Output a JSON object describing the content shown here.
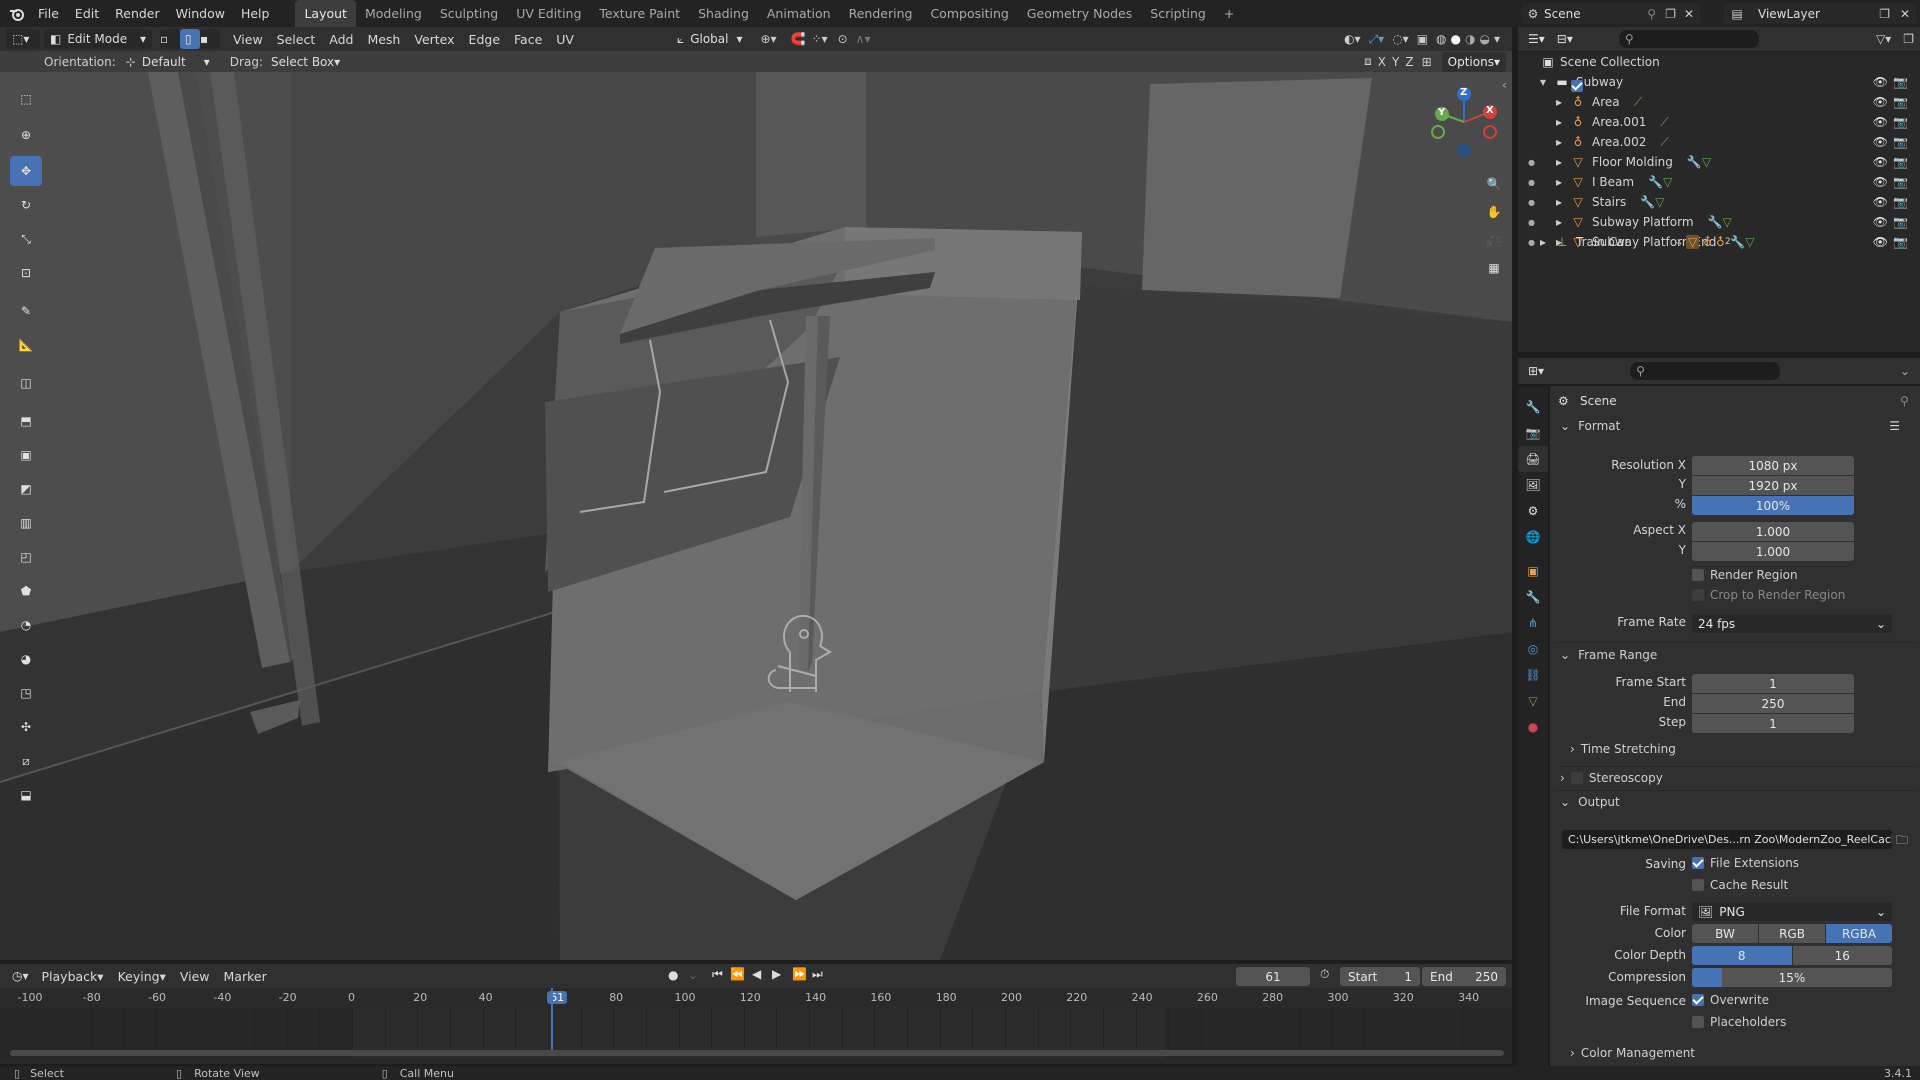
{
  "topbar": {
    "menus": [
      "File",
      "Edit",
      "Render",
      "Window",
      "Help"
    ],
    "workspaces": [
      "Layout",
      "Modeling",
      "Sculpting",
      "UV Editing",
      "Texture Paint",
      "Shading",
      "Animation",
      "Rendering",
      "Compositing",
      "Geometry Nodes",
      "Scripting"
    ],
    "active_workspace": "Layout",
    "add_tab": "+",
    "scene_label": "Scene",
    "viewlayer_label": "ViewLayer"
  },
  "viewport_header": {
    "mode": "Edit Mode",
    "menus": [
      "View",
      "Select",
      "Add",
      "Mesh",
      "Vertex",
      "Edge",
      "Face",
      "UV"
    ],
    "transform_orientation": "Global",
    "orientation_label": "Orientation:",
    "orientation_value": "Default",
    "drag_label": "Drag:",
    "drag_value": "Select Box",
    "axis_x": "X",
    "axis_y": "Y",
    "axis_z": "Z",
    "options": "Options"
  },
  "gizmo": {
    "x": "X",
    "y": "Y",
    "z": "Z"
  },
  "tools": [
    "select-box",
    "cursor",
    "move",
    "rotate",
    "scale",
    "transform",
    "annotate",
    "measure",
    "add-cube",
    "extrude",
    "inset",
    "bevel",
    "loop-cut",
    "knife",
    "poly-build",
    "spin",
    "smooth",
    "edge-slide",
    "shrink-fatten",
    "shear",
    "rip"
  ],
  "outliner": {
    "search_placeholder": "",
    "root": "Scene Collection",
    "collection": "Subway",
    "items": [
      {
        "name": "Area",
        "type": "light"
      },
      {
        "name": "Area.001",
        "type": "light"
      },
      {
        "name": "Area.002",
        "type": "light"
      },
      {
        "name": "Floor Molding",
        "type": "mesh"
      },
      {
        "name": "I Beam",
        "type": "mesh"
      },
      {
        "name": "Stairs",
        "type": "mesh"
      },
      {
        "name": "Subway Platform",
        "type": "mesh"
      },
      {
        "name": "Subway PlatformEnd",
        "type": "mesh"
      }
    ],
    "train_car": "Train Car",
    "train_car_badge": "2"
  },
  "properties": {
    "context": "Scene",
    "format": {
      "title": "Format",
      "res_x_label": "Resolution X",
      "res_x": "1080 px",
      "res_y_label": "Y",
      "res_y": "1920 px",
      "pct_label": "%",
      "pct": "100%",
      "aspect_x_label": "Aspect X",
      "aspect_x": "1.000",
      "aspect_y_label": "Y",
      "aspect_y": "1.000",
      "render_region": "Render Region",
      "crop_region": "Crop to Render Region",
      "frame_rate_label": "Frame Rate",
      "frame_rate": "24 fps"
    },
    "frame_range": {
      "title": "Frame Range",
      "start_label": "Frame Start",
      "start": "1",
      "end_label": "End",
      "end": "250",
      "step_label": "Step",
      "step": "1"
    },
    "time_stretching": "Time Stretching",
    "stereoscopy": "Stereoscopy",
    "output": {
      "title": "Output",
      "path": "C:\\Users\\jtkme\\OneDrive\\Des...rn Zoo\\ModernZoo_ReelCache\\",
      "saving_label": "Saving",
      "file_extensions": "File Extensions",
      "cache_result": "Cache Result",
      "file_format_label": "File Format",
      "file_format": "PNG",
      "color_label": "Color",
      "color_options": [
        "BW",
        "RGB",
        "RGBA"
      ],
      "color_active": "RGBA",
      "depth_label": "Color Depth",
      "depth_options": [
        "8",
        "16"
      ],
      "depth_active": "8",
      "compression_label": "Compression",
      "compression": "15%",
      "compression_value": 0.15,
      "image_seq_label": "Image Sequence",
      "overwrite": "Overwrite",
      "placeholders": "Placeholders"
    },
    "color_management": "Color Management"
  },
  "timeline": {
    "menus": [
      "Playback",
      "Keying",
      "View",
      "Marker"
    ],
    "current_frame": "61",
    "start_label": "Start",
    "start": "1",
    "end_label": "End",
    "end": "250",
    "ruler": [
      "-100",
      "-80",
      "-60",
      "-40",
      "-20",
      "0",
      "20",
      "40",
      "61",
      "80",
      "100",
      "120",
      "140",
      "160",
      "180",
      "200",
      "220",
      "240",
      "260",
      "280",
      "300",
      "320",
      "340"
    ]
  },
  "statusbar": {
    "select": "Select",
    "rotate": "Rotate View",
    "call_menu": "Call Menu",
    "version": "3.4.1"
  },
  "colors": {
    "accent": "#4772b3",
    "panel": "#303030",
    "viewport": "#3d3d3d"
  }
}
